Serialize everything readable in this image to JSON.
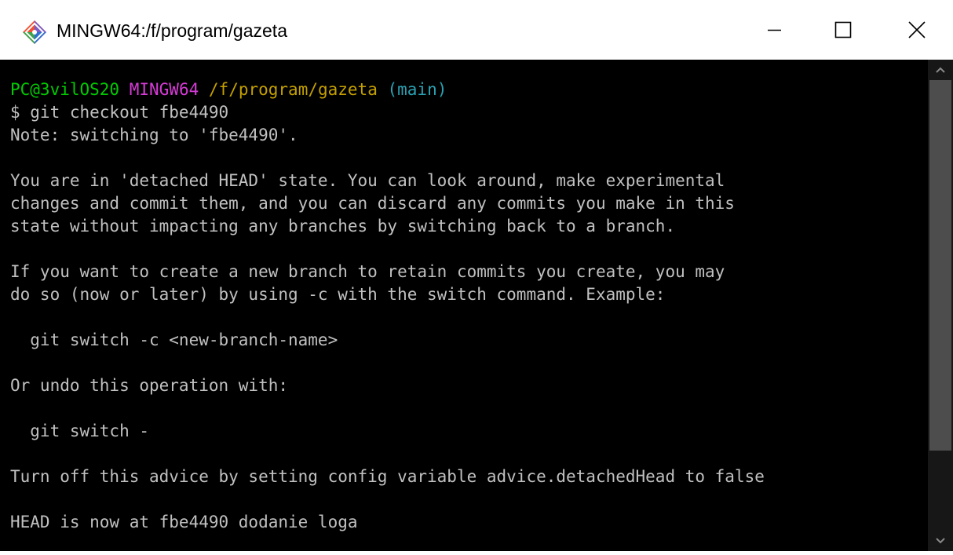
{
  "window": {
    "title": "MINGW64:/f/program/gazeta",
    "app_icon": "git-bash-icon",
    "buttons": {
      "minimize_icon": "minimize-icon",
      "maximize_icon": "maximize-icon",
      "close_icon": "close-icon"
    }
  },
  "terminal": {
    "prompt": {
      "user_host": "PC@3vilOS20",
      "system": "MINGW64",
      "path": "/f/program/gazeta",
      "branch": "(main)"
    },
    "command": "$ git checkout fbe4490",
    "output": [
      "Note: switching to 'fbe4490'.",
      "",
      "You are in 'detached HEAD' state. You can look around, make experimental",
      "changes and commit them, and you can discard any commits you make in this",
      "state without impacting any branches by switching back to a branch.",
      "",
      "If you want to create a new branch to retain commits you create, you may",
      "do so (now or later) by using -c with the switch command. Example:",
      "",
      "  git switch -c <new-branch-name>",
      "",
      "Or undo this operation with:",
      "",
      "  git switch -",
      "",
      "Turn off this advice by setting config variable advice.detachedHead to false",
      "",
      "HEAD is now at fbe4490 dodanie loga"
    ]
  },
  "scrollbar": {
    "up_icon": "scroll-up-arrow-icon",
    "down_icon": "scroll-down-arrow-icon"
  },
  "colors": {
    "user_host": "#00cc00",
    "system": "#d63bd6",
    "path": "#c4a000",
    "branch": "#2aa1b3",
    "text": "#c0c0c0",
    "background": "#000000"
  }
}
